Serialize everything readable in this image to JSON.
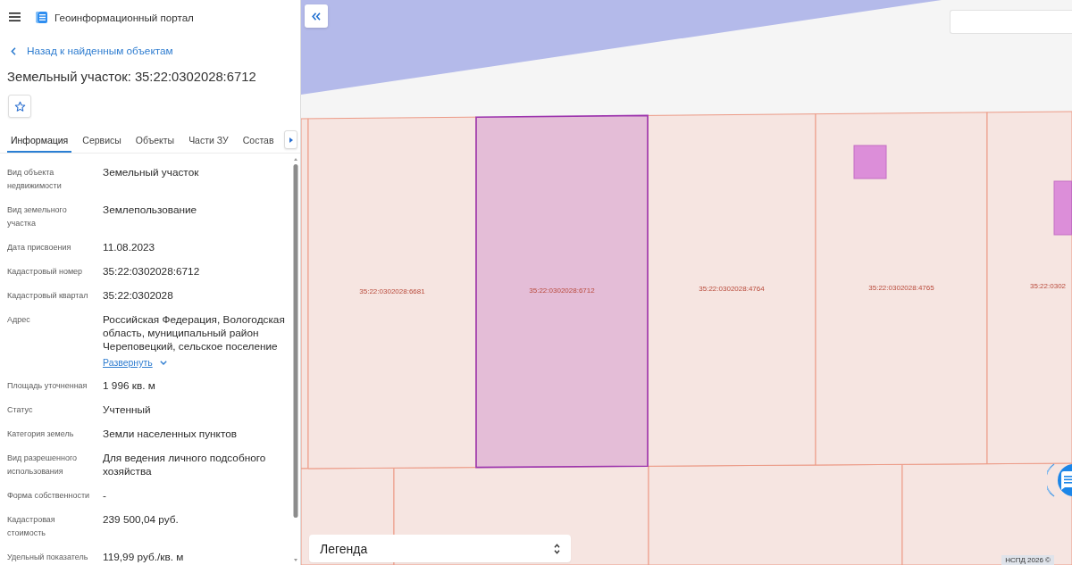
{
  "header": {
    "title": "Геоинформационный портал"
  },
  "back_link": "Назад к найденным объектам",
  "object_title": "Земельный участок: 35:22:0302028:6712",
  "tabs": [
    {
      "label": "Информация",
      "selected": true
    },
    {
      "label": "Сервисы",
      "selected": false
    },
    {
      "label": "Объекты",
      "selected": false
    },
    {
      "label": "Части ЗУ",
      "selected": false
    },
    {
      "label": "Состав",
      "selected": false
    }
  ],
  "fields": [
    {
      "label": "Вид объекта недвижимости",
      "value": "Земельный участок"
    },
    {
      "label": "Вид земельного участка",
      "value": "Землепользование"
    },
    {
      "label": "Дата присвоения",
      "value": "11.08.2023"
    },
    {
      "label": "Кадастровый номер",
      "value": "35:22:0302028:6712"
    },
    {
      "label": "Кадастровый квартал",
      "value": "35:22:0302028"
    },
    {
      "label": "Адрес",
      "value": "Российская Федерация, Вологодская область, муниципальный район Череповецкий, сельское поселение",
      "expand_link": "Развернуть"
    },
    {
      "label": "Площадь уточненная",
      "value": "1 996 кв. м"
    },
    {
      "label": "Статус",
      "value": "Учтенный"
    },
    {
      "label": "Категория земель",
      "value": "Земли населенных пунктов"
    },
    {
      "label": "Вид разрешенного использования",
      "value": "Для ведения личного подсобного хозяйства"
    },
    {
      "label": "Форма собственности",
      "value": "-"
    },
    {
      "label": "Кадастровая стоимость",
      "value": "239 500,04 руб."
    },
    {
      "label": "Удельный показатель",
      "value": "119,99 руб./кв. м"
    }
  ],
  "map": {
    "parcels": [
      {
        "label": "35:22:0302028:6681",
        "selected": false
      },
      {
        "label": "35:22:0302028:6712",
        "selected": true
      },
      {
        "label": "35:22:0302028:4764",
        "selected": false
      },
      {
        "label": "35:22:0302028:4765",
        "selected": false
      },
      {
        "label": "35:22:0302",
        "selected": false
      }
    ],
    "legend": "Легенда",
    "attribution": "НСПД 2026 ©"
  }
}
